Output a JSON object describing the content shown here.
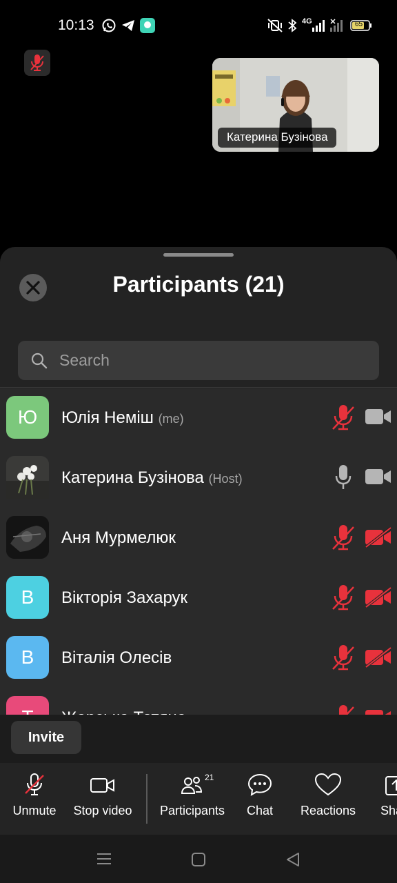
{
  "status_bar": {
    "time": "10:13",
    "battery": "65",
    "network": "4G",
    "app_icons": [
      "whatsapp-icon",
      "telegram-icon",
      "chat-bubble-app-icon"
    ]
  },
  "video": {
    "self_muted_icon": "mic-muted-icon",
    "thumbnail_name": "Катерина Бузінова"
  },
  "sheet": {
    "title": "Participants (21)",
    "close_icon": "close-icon",
    "search_placeholder": "Search"
  },
  "participants": [
    {
      "initial": "Ю",
      "name": "Юлія Неміш",
      "tag": "(me)",
      "avatar_color": "#7cc87c",
      "mic": "muted",
      "video": "on"
    },
    {
      "initial": "",
      "name": "Катерина Бузінова",
      "tag": "(Host)",
      "avatar_color": "#3b3b3b",
      "mic": "on",
      "video": "on"
    },
    {
      "initial": "",
      "name": "Аня Мурмелюк",
      "tag": "",
      "avatar_color": "#1a1a1a",
      "mic": "muted",
      "video": "off"
    },
    {
      "initial": "В",
      "name": "Вікторія Захарук",
      "tag": "",
      "avatar_color": "#4dd0e1",
      "mic": "muted",
      "video": "off"
    },
    {
      "initial": "В",
      "name": "Віталія Олесів",
      "tag": "",
      "avatar_color": "#5bb8f0",
      "mic": "muted",
      "video": "off"
    },
    {
      "initial": "Т",
      "name": "Жарська Тетяна",
      "tag": "",
      "avatar_color": "#e84a7a",
      "mic": "muted",
      "video": "off"
    }
  ],
  "invite": {
    "label": "Invite"
  },
  "toolbar": {
    "unmute": "Unmute",
    "stop_video": "Stop video",
    "participants": "Participants",
    "participants_count": "21",
    "chat": "Chat",
    "reactions": "Reactions",
    "share": "Sha"
  },
  "colors": {
    "muted_red": "#e8323c",
    "icon_gray": "#b5b5b5",
    "sheet_bg": "#232323"
  }
}
